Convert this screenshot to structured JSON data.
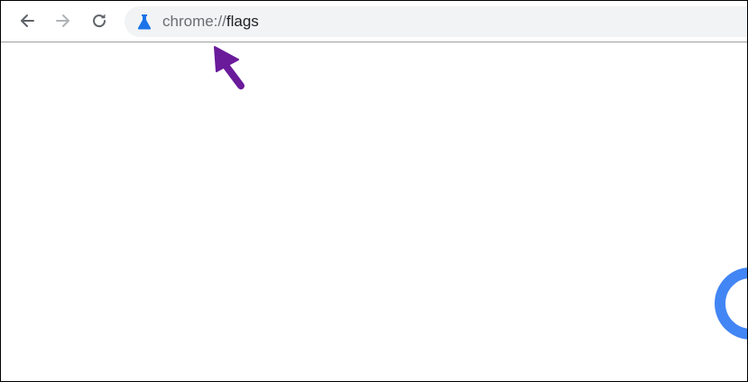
{
  "browser": {
    "toolbar": {
      "back_icon": "arrow-left-icon",
      "forward_icon": "arrow-right-icon",
      "forward_enabled": false,
      "reload_icon": "reload-icon"
    },
    "omnibox": {
      "site_icon": "flask-icon",
      "url_scheme": "chrome://",
      "url_host": "flags"
    }
  },
  "page": {
    "loading_indicator": "spinner-icon"
  },
  "annotation": {
    "pointer": "arrow-pointer-icon"
  },
  "colors": {
    "frame_border": "#000000",
    "omnibox_background": "#f1f3f4",
    "flask_icon": "#1a73e8",
    "spinner": "#4285f4",
    "arrow": "#6a1b9a",
    "forward_disabled": "#b0b3b6",
    "nav_icon": "#5f6368"
  }
}
